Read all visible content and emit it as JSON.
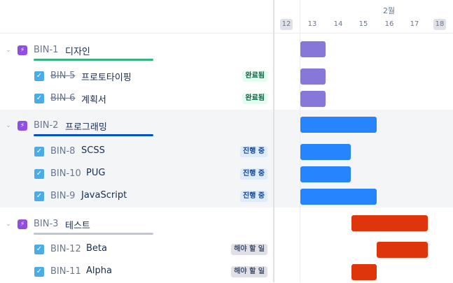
{
  "colors": {
    "epic_icon": "#904ee2",
    "check": "#4bade8",
    "bar_purple": "#8777d9",
    "bar_blue": "#2684ff",
    "bar_red": "#de350b"
  },
  "timeline": {
    "month": "2월",
    "days": [
      "12",
      "13",
      "14",
      "15",
      "16",
      "17",
      "18"
    ]
  },
  "epics": [
    {
      "key": "BIN-1",
      "name": "디자인",
      "bar_color": "#36b37e"
    },
    {
      "key": "BIN-2",
      "name": "프로그래밍",
      "bar_color": "#0052cc"
    },
    {
      "key": "BIN-3",
      "name": "테스트",
      "bar_color": "#c1c7d0"
    }
  ],
  "issues": [
    {
      "key": "BIN-5",
      "name": "프로토타이핑",
      "status": "완료됨"
    },
    {
      "key": "BIN-6",
      "name": "계획서",
      "status": "완료됨"
    },
    {
      "key": "BIN-8",
      "name": "SCSS",
      "status": "진행 중"
    },
    {
      "key": "BIN-10",
      "name": "PUG",
      "status": "진행 중"
    },
    {
      "key": "BIN-9",
      "name": "JavaScript",
      "status": "진행 중"
    },
    {
      "key": "BIN-12",
      "name": "Beta",
      "status": "해야 할 일"
    },
    {
      "key": "BIN-11",
      "name": "Alpha",
      "status": "해야 할 일"
    }
  ]
}
